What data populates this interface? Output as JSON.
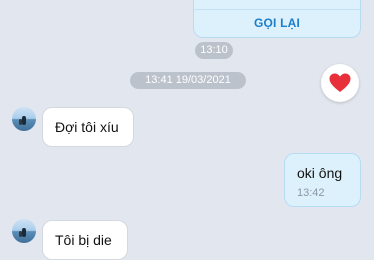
{
  "call_card": {
    "action_label": "GỌI LẠI"
  },
  "timestamps": {
    "first": "13:10",
    "divider": "13:41 19/03/2021"
  },
  "reaction": {
    "icon": "heart-icon",
    "color": "#e8303a"
  },
  "messages": [
    {
      "direction": "incoming",
      "text": "Đợi tôi xíu"
    },
    {
      "direction": "outgoing",
      "text": "oki ông",
      "time": "13:42"
    },
    {
      "direction": "incoming",
      "text": "Tôi bị die"
    }
  ],
  "colors": {
    "background": "#e2e6ee",
    "outgoing_bubble": "#ddf1fc",
    "accent": "#1a7ecb"
  }
}
